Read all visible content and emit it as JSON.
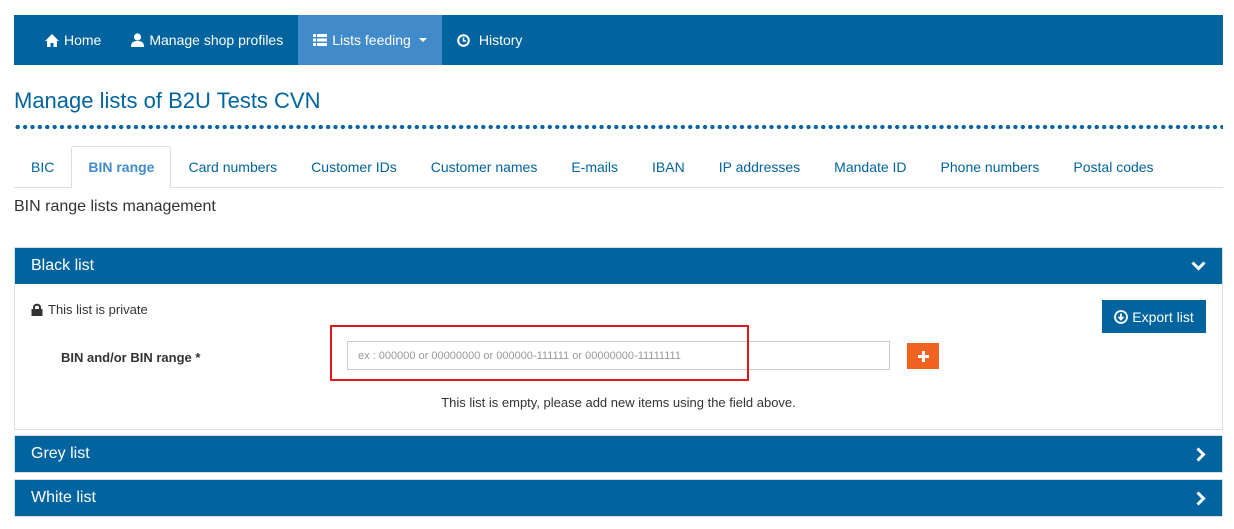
{
  "navbar": {
    "items": [
      {
        "label": "Home",
        "icon": "home-icon",
        "active": false
      },
      {
        "label": "Manage shop profiles",
        "icon": "user-icon",
        "active": false
      },
      {
        "label": "Lists feeding",
        "icon": "list-icon",
        "active": true,
        "dropdown": true
      },
      {
        "label": "History",
        "icon": "clock-icon",
        "active": false
      }
    ]
  },
  "page": {
    "title": "Manage lists of B2U Tests CVN",
    "section_title": "BIN range lists management"
  },
  "tabs": [
    {
      "label": "BIC",
      "active": false
    },
    {
      "label": "BIN range",
      "active": true
    },
    {
      "label": "Card numbers",
      "active": false
    },
    {
      "label": "Customer IDs",
      "active": false
    },
    {
      "label": "Customer names",
      "active": false
    },
    {
      "label": "E-mails",
      "active": false
    },
    {
      "label": "IBAN",
      "active": false
    },
    {
      "label": "IP addresses",
      "active": false
    },
    {
      "label": "Mandate ID",
      "active": false
    },
    {
      "label": "Phone numbers",
      "active": false
    },
    {
      "label": "Postal codes",
      "active": false
    }
  ],
  "panels": {
    "black": {
      "title": "Black list",
      "expanded": true,
      "privacy_text": "This list is private",
      "export_label": "Export list",
      "field_label": "BIN and/or BIN range *",
      "input_value": "",
      "input_placeholder": "ex : 000000 or 00000000 or 000000-111111 or 00000000-11111111",
      "add_label": "+",
      "empty_message": "This list is empty, please add new items using the field above."
    },
    "grey": {
      "title": "Grey list",
      "expanded": false
    },
    "white": {
      "title": "White list",
      "expanded": false
    }
  },
  "colors": {
    "primary": "#02649f",
    "active_nav": "#428bca",
    "add_button": "#f26322",
    "highlight": "#e0161f"
  }
}
